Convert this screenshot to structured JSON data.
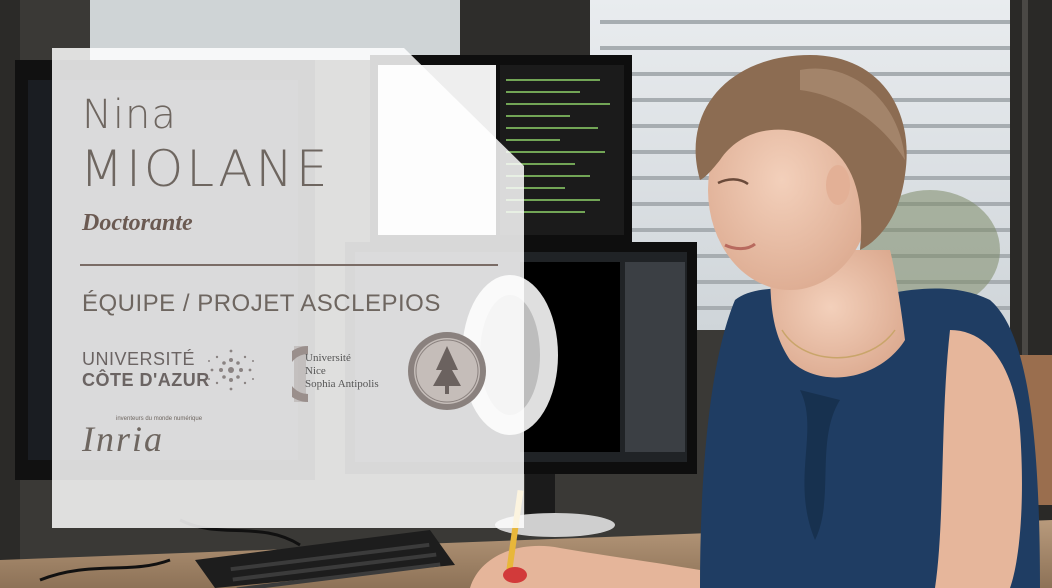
{
  "profile": {
    "first_name": "Nina",
    "last_name": "MIOLANE",
    "role": "Doctorante",
    "team": "ÉQUIPE / PROJET ASCLEPIOS"
  },
  "logos": {
    "uca_line1": "UNIVERSITÉ",
    "uca_line2": "CÔTE D'AZUR",
    "unice_line1": "Université",
    "unice_line2": "Nice",
    "unice_line3": "Sophia Antipolis",
    "inria": "Inria",
    "inria_tagline": "inventeurs du monde numérique"
  },
  "colors": {
    "card": "#ffffff",
    "text": "#6e6660",
    "dress": "#1f3d63",
    "hair": "#8c6c52"
  },
  "icons": [
    "uca-dots-logo",
    "unice-logo",
    "university-seal-logo",
    "inria-logo"
  ]
}
